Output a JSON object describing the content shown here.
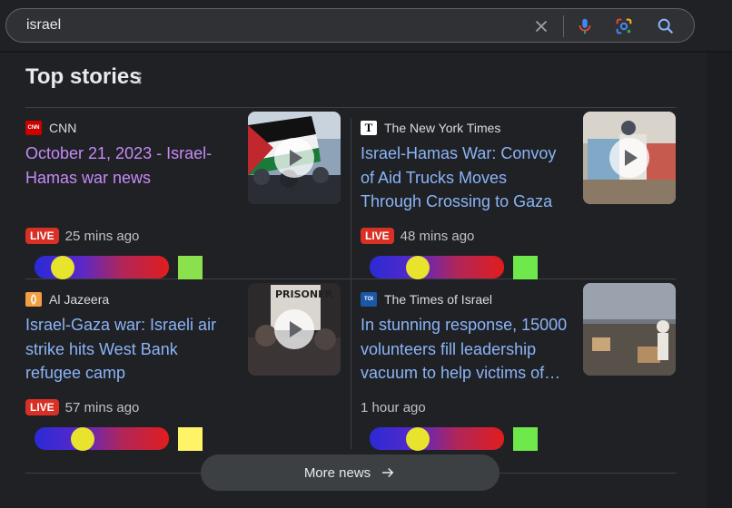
{
  "search": {
    "query": "israel"
  },
  "section": {
    "title": "Top stories"
  },
  "stories": [
    {
      "publisher": "CNN",
      "logo_text": "CNN",
      "logo_color": "#cc0000",
      "headline": "October 21, 2023 - Israel-Hamas war news",
      "live": "LIVE",
      "time": "25 mins ago",
      "slider_level": 0.15,
      "swatch_color": "#8be04e",
      "has_video": true
    },
    {
      "publisher": "The New York Times",
      "logo_text": "T",
      "logo_color": "#ffffff",
      "headline": "Israel-Hamas War: Convoy of Aid Trucks Moves Through Crossing to Gaza",
      "live": "LIVE",
      "time": "48 mins ago",
      "slider_level": 0.33,
      "swatch_color": "#6ee84a",
      "has_video": true
    },
    {
      "publisher": "Al Jazeera",
      "logo_text": "",
      "logo_color": "#f0a043",
      "headline": "Israel-Gaza war: Israeli air strike hits West Bank refugee camp",
      "live": "LIVE",
      "time": "57 mins ago",
      "slider_level": 0.33,
      "swatch_color": "#fff467",
      "has_video": true
    },
    {
      "publisher": "The Times of Israel",
      "logo_text": "TOI",
      "logo_color": "#1a57a6",
      "headline": "In stunning response, 15000 volunteers fill leadership vacuum to help victims of…",
      "live": "",
      "time": "1 hour ago",
      "slider_level": 0.33,
      "swatch_color": "#6ee84a",
      "has_video": false
    }
  ],
  "more_button": {
    "label": "More news"
  }
}
